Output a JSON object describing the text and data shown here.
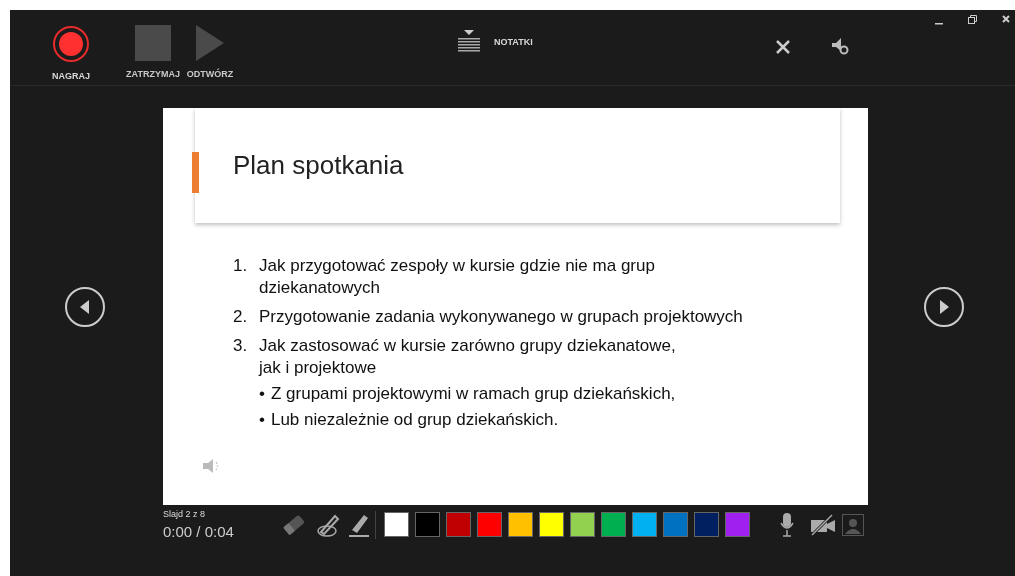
{
  "toolbar": {
    "buttons": [
      {
        "kind": "record",
        "label": "NAGRAJ",
        "disabled": false
      },
      {
        "kind": "stop",
        "label": "ZATRZYMAJ",
        "disabled": true
      },
      {
        "kind": "play",
        "label": "ODTWÓRZ",
        "disabled": true
      }
    ],
    "notes_button": {
      "label": "NOTATKI"
    }
  },
  "slide": {
    "title": "Plan spotkania",
    "items": [
      {
        "number": "1.",
        "lines": [
          "Jak przygotować zespoły w kursie gdzie nie ma grup",
          "dziekanatowych"
        ]
      },
      {
        "number": "2.",
        "lines": [
          "Przygotowanie zadania wykonywanego w grupach projektowych"
        ]
      },
      {
        "number": "3.",
        "lines": [
          "Jak zastosować w kursie zarówno grupy dziekanatowe,",
          "jak i projektowe"
        ],
        "children": [
          {
            "bullet": "•",
            "text": "Z grupami projektowymi w ramach grup dziekańskich,"
          },
          {
            "bullet": "•",
            "text": "Lub niezależnie od grup dziekańskich."
          }
        ]
      }
    ]
  },
  "status": {
    "slide_counter": "Slajd 2 z 8",
    "time": "0:00 / 0:04"
  },
  "pen_colors": [
    {
      "color": "#ffffff"
    },
    {
      "color": "#000000"
    },
    {
      "color": "#c00000"
    },
    {
      "color": "#ff0000"
    },
    {
      "color": "#ffc000"
    },
    {
      "color": "#ffff00"
    },
    {
      "color": "#92d050"
    },
    {
      "color": "#00b050"
    },
    {
      "color": "#00b0f0"
    },
    {
      "color": "#0070c0"
    },
    {
      "color": "#002060"
    },
    {
      "color": "#a020f0"
    }
  ],
  "media": {
    "microphone_on": true,
    "camera_on": false,
    "camera_preview_on": false
  }
}
